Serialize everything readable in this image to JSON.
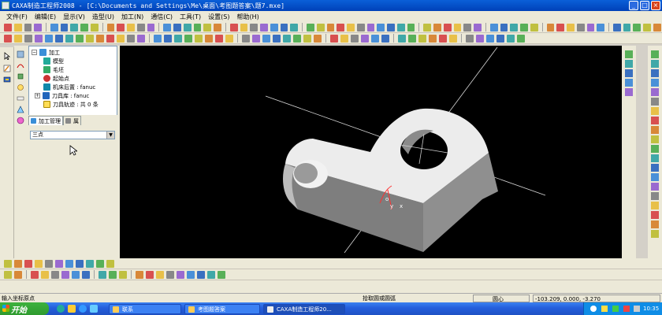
{
  "window": {
    "title": "CAXA制造工程师2008  - [C:\\Documents and Settings\\Me\\桌面\\考图题答案\\题7.mxe]",
    "controls": [
      "minimize-icon",
      "maximize-icon",
      "close-icon"
    ]
  },
  "menu": [
    "文件(F)",
    "编辑(E)",
    "显示(V)",
    "造型(U)",
    "加工(N)",
    "通信(C)",
    "工具(T)",
    "设置(S)",
    "帮助(H)"
  ],
  "tree": {
    "root": "加工",
    "items": [
      {
        "label": "模型",
        "icon": "model-icon"
      },
      {
        "label": "毛坯",
        "icon": "blank-icon"
      },
      {
        "label": "起始点",
        "icon": "start-point-icon"
      },
      {
        "label": "机床后置 : fanuc",
        "icon": "machine-post-icon"
      },
      {
        "label": "刀具库 : fanuc",
        "icon": "tool-library-icon"
      },
      {
        "label": "刀具轨迹 : 共 0 条",
        "icon": "toolpath-icon"
      }
    ]
  },
  "panel_tabs": [
    "加工管理",
    "属"
  ],
  "property_combo": {
    "value": "三点"
  },
  "status": {
    "prompt": "输入坐标原点",
    "mode": "拾取圆或圆弧",
    "snap": "圆心",
    "coords": "-103.209, 0.000, -3.270"
  },
  "taskbar": {
    "start": "开始",
    "buttons": [
      {
        "label": "联系",
        "active": false
      },
      {
        "label": "考图题答案",
        "active": false
      },
      {
        "label": "CAXA制造工程师20...",
        "active": true
      }
    ],
    "clock": "10:35"
  },
  "viewport": {
    "axis_label_y": "y",
    "axis_label_x": "x",
    "axis_label_o": "o"
  },
  "colors": {
    "title_bar": "#0a5fd8",
    "viewport_bg": "#000000",
    "model": "#e8e8e8",
    "axis_red": "#ff3030"
  }
}
